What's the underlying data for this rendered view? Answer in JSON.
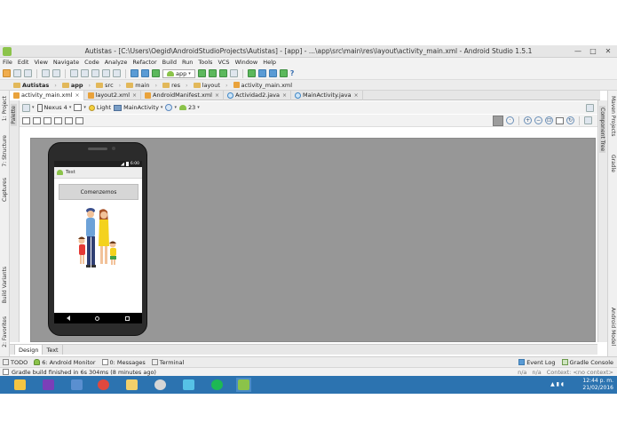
{
  "window": {
    "title": "Autistas - [C:\\Users\\Oegid\\AndroidStudioProjects\\Autistas] - [app] - ...\\app\\src\\main\\res\\layout\\activity_main.xml - Android Studio 1.5.1",
    "min": "—",
    "max": "□",
    "close": "✕"
  },
  "menu": [
    "File",
    "Edit",
    "View",
    "Navigate",
    "Code",
    "Analyze",
    "Refactor",
    "Build",
    "Run",
    "Tools",
    "VCS",
    "Window",
    "Help"
  ],
  "toolbar": {
    "run_config": "app",
    "help": "?"
  },
  "breadcrumb": [
    "Autistas",
    "app",
    "src",
    "main",
    "res",
    "layout",
    "activity_main.xml"
  ],
  "editor_tabs": [
    {
      "label": "activity_main.xml",
      "type": "xml",
      "active": true
    },
    {
      "label": "layout2.xml",
      "type": "xml",
      "active": false
    },
    {
      "label": "AndroidManifest.xml",
      "type": "xml",
      "active": false
    },
    {
      "label": "Actividad2.java",
      "type": "java",
      "active": false
    },
    {
      "label": "MainActivity.java",
      "type": "java",
      "active": false
    }
  ],
  "tab_close": "×",
  "layout_toolbar": {
    "device": "Nexus 4",
    "theme": "Light",
    "activity": "MainActivity",
    "api": "23",
    "dropdown": "▾"
  },
  "side_panels": {
    "left": [
      "1: Project",
      "7: Structure",
      "Captures",
      "Build Variants",
      "2: Favorites"
    ],
    "palette": "Palette",
    "right": [
      "Maven Projects",
      "Gradle",
      "Android Model"
    ],
    "component_tree": "Component Tree"
  },
  "preview": {
    "time": "6:00",
    "app_title": "Test",
    "button_label": "Comenzemos",
    "nav_back": "◁",
    "nav_home": "○",
    "nav_recent": "□"
  },
  "design_tabs": [
    "Design",
    "Text"
  ],
  "tool_windows": [
    "TODO",
    "6: Android Monitor",
    "0: Messages",
    "Terminal"
  ],
  "tool_windows_right": [
    "Event Log",
    "Gradle Console"
  ],
  "status": {
    "message": "Gradle build finished in 6s 304ms (8 minutes ago)",
    "na1": "n/a",
    "na2": "n/a",
    "context": "Context: <no context>"
  },
  "taskbar": {
    "time": "12:44 p. m.",
    "date": "21/02/2016",
    "tray": "▲  ▮  ◖"
  },
  "colors": {
    "canvas": "#979797",
    "taskbar": "#2c73b0",
    "android_green": "#8bc34a"
  }
}
